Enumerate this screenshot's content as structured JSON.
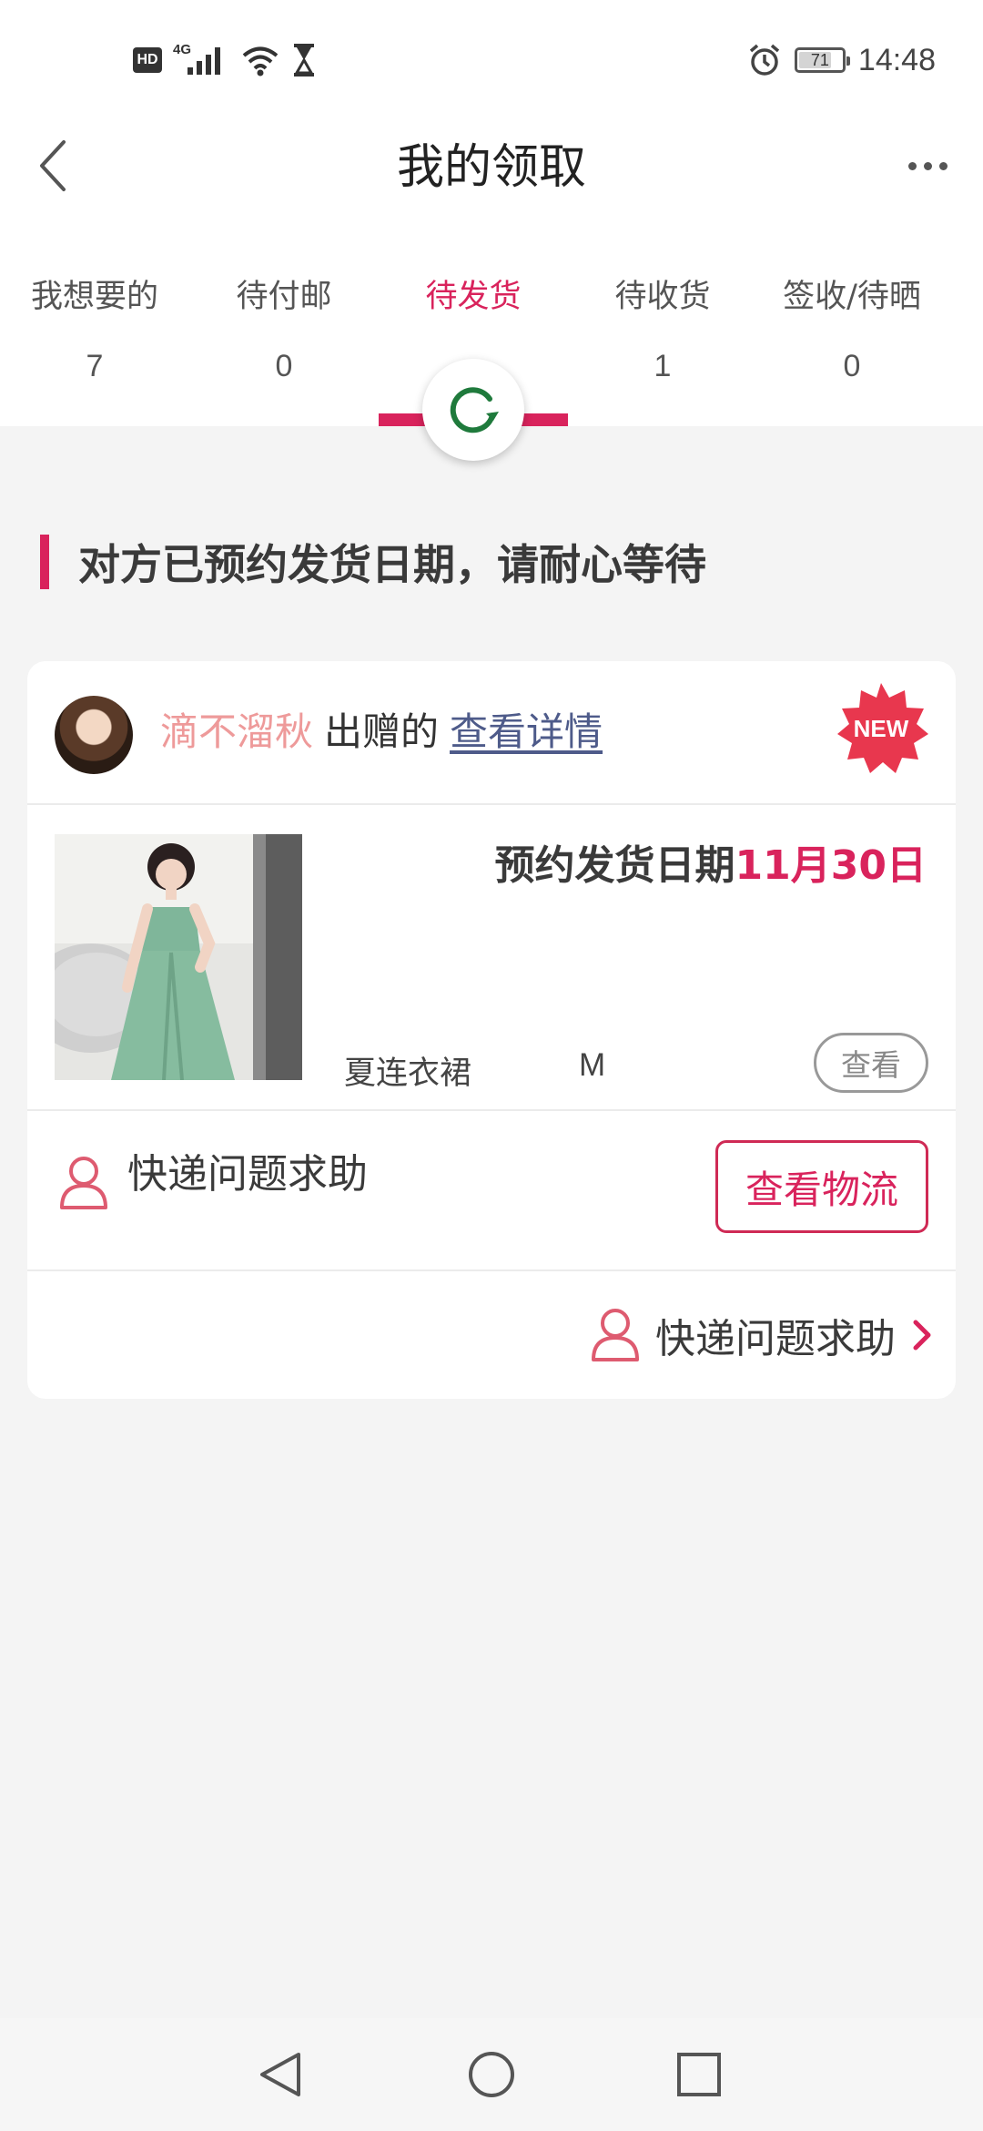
{
  "status_bar": {
    "hd_badge": "HD",
    "network_type": "4G",
    "battery_level": "71",
    "time": "14:48",
    "icons": [
      "hd-icon",
      "signal-icon",
      "wifi-icon",
      "hourglass-icon",
      "alarm-icon",
      "battery-icon"
    ]
  },
  "header": {
    "title": "我的领取",
    "back_icon": "chevron-left-icon",
    "more_icon": "more-dots-icon"
  },
  "tabs": [
    {
      "label": "我想要的",
      "count": "7"
    },
    {
      "label": "待付邮",
      "count": "0"
    },
    {
      "label": "待发货",
      "count": "",
      "active": true
    },
    {
      "label": "待收货",
      "count": "1"
    },
    {
      "label": "签收/待晒",
      "count": "0"
    }
  ],
  "section": {
    "heading": "对方已预约发货日期，请耐心等待"
  },
  "card": {
    "giver_name": "滴不溜秋",
    "giver_suffix": "出赠的",
    "detail_link": "查看详情",
    "new_badge": "NEW",
    "ship_label": "预约发货日期",
    "ship_date": "11月30日",
    "product_name": "夏连衣裙",
    "product_size": "M",
    "view_button": "查看",
    "help_label": "快递问题求助",
    "logistics_button": "查看物流",
    "help_link": "快递问题求助"
  },
  "colors": {
    "accent": "#d9235c",
    "giver_name": "#ee9a9a",
    "link": "#4e5b8a",
    "refresh_green": "#1f7a3c",
    "background": "#f4f4f4"
  },
  "nav": {
    "icons": [
      "nav-back-icon",
      "nav-home-icon",
      "nav-recents-icon"
    ]
  }
}
